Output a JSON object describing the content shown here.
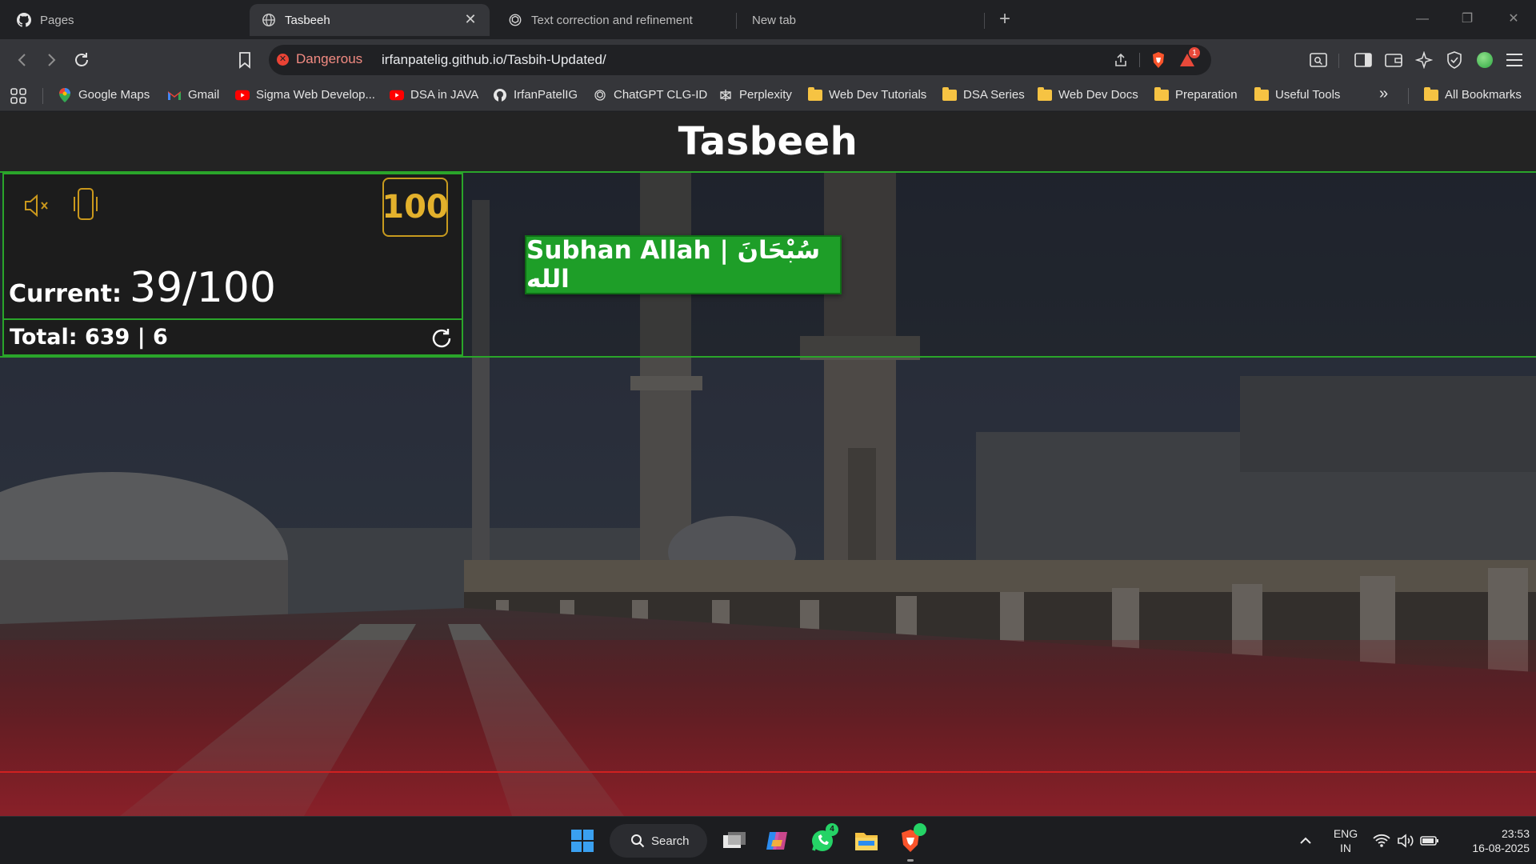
{
  "browser": {
    "tabs": [
      {
        "title": "Pages",
        "icon": "github-icon",
        "active": false
      },
      {
        "title": "Tasbeeh",
        "icon": "globe-icon",
        "active": true
      },
      {
        "title": "Text correction and refinement",
        "icon": "chatgpt-icon",
        "active": false
      },
      {
        "title": "New tab",
        "icon": "",
        "active": false
      }
    ],
    "security_label": "Dangerous",
    "url": "irfanpatelig.github.io/Tasbih-Updated/",
    "notification_count": "1",
    "bookmarks": [
      {
        "label": "Google Maps",
        "icon": "google-maps-icon"
      },
      {
        "label": "Gmail",
        "icon": "gmail-icon"
      },
      {
        "label": "Sigma Web Develop...",
        "icon": "youtube-icon"
      },
      {
        "label": "DSA in JAVA",
        "icon": "youtube-icon"
      },
      {
        "label": "IrfanPatelIG",
        "icon": "github-icon"
      },
      {
        "label": "ChatGPT CLG-ID",
        "icon": "chatgpt-icon"
      },
      {
        "label": "Perplexity",
        "icon": "perplexity-icon"
      },
      {
        "label": "Web Dev Tutorials",
        "icon": "folder-icon"
      },
      {
        "label": "DSA Series",
        "icon": "folder-icon"
      },
      {
        "label": "Web Dev Docs",
        "icon": "folder-icon"
      },
      {
        "label": "Preparation",
        "icon": "folder-icon"
      },
      {
        "label": "Useful Tools",
        "icon": "folder-icon"
      }
    ],
    "more_bookmarks": "»",
    "all_bookmarks": "All Bookmarks"
  },
  "app": {
    "title": "Tasbeeh",
    "target": "100",
    "current_label": "Current:",
    "current_value": "39/100",
    "total_text": "Total: 639 | 6",
    "dhikr_label": "Subhan Allah | سُبْحَانَ الله",
    "accent_green": "#2aa52a",
    "button_green": "#1e9e28",
    "gold": "#e3b12c"
  },
  "taskbar": {
    "search_label": "Search",
    "whatsapp_badge": "4",
    "lang_line1": "ENG",
    "lang_line2": "IN",
    "time": "23:53",
    "date": "16-08-2025"
  }
}
